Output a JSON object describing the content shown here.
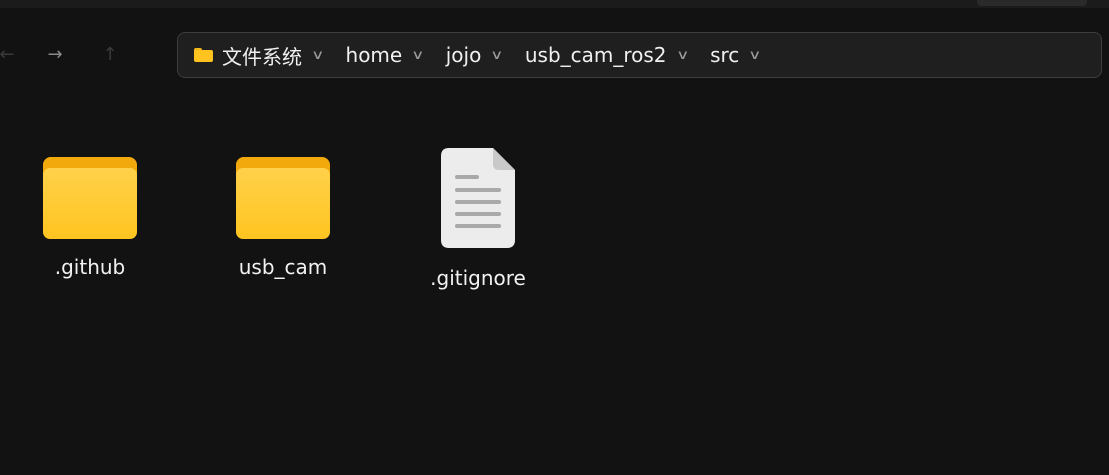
{
  "window": {
    "nav": {
      "back_icon": "←",
      "forward_icon": "→",
      "up_icon": "↑"
    }
  },
  "pathbar": {
    "crumbs": [
      {
        "label": "文件系统",
        "icon": "folder-icon"
      },
      {
        "label": "home"
      },
      {
        "label": "jojo"
      },
      {
        "label": "usb_cam_ros2"
      },
      {
        "label": "src"
      }
    ],
    "chevron": "∨"
  },
  "files": [
    {
      "name": ".github",
      "type": "folder",
      "icon": "folder-icon"
    },
    {
      "name": "usb_cam",
      "type": "folder",
      "icon": "folder-icon"
    },
    {
      "name": ".gitignore",
      "type": "text file",
      "icon": "text-file-icon"
    }
  ],
  "colors": {
    "background": "#121212",
    "folder": "#ffc420",
    "folder_tab": "#f2a90c"
  }
}
